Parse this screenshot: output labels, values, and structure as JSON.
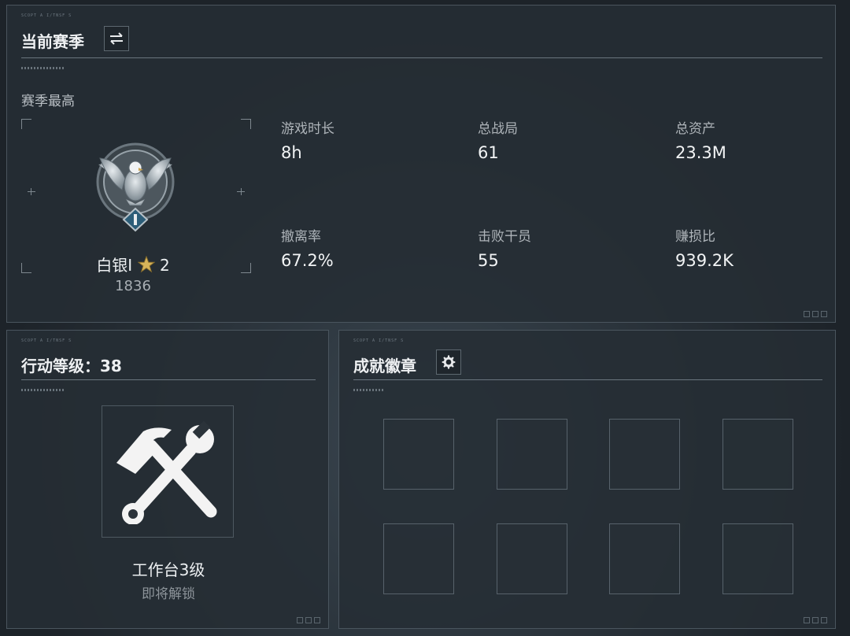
{
  "season": {
    "title": "当前赛季",
    "tiny_code": "SCOPT A I/TNSF S",
    "switch_icon": "swap-arrows-icon",
    "section_label": "赛季最高",
    "rank": {
      "name": "白银I",
      "star_icon": "gold-star-icon",
      "stars": "2",
      "score": "1836",
      "emblem_icon": "silver-eagle-emblem-icon"
    },
    "stats": [
      {
        "label": "游戏时长",
        "value": "8h"
      },
      {
        "label": "总战局",
        "value": "61"
      },
      {
        "label": "总资产",
        "value": "23.3M"
      },
      {
        "label": "撤离率",
        "value": "67.2%"
      },
      {
        "label": "击败干员",
        "value": "55"
      },
      {
        "label": "赚损比",
        "value": "939.2K"
      }
    ]
  },
  "level": {
    "title": "行动等级：38",
    "tiny_code": "SCOPT A I/TNSF S",
    "unlock_icon": "hammer-wrench-icon",
    "unlock_name": "工作台3级",
    "unlock_status": "即将解锁"
  },
  "badges": {
    "title": "成就徽章",
    "tiny_code": "SCOPT A I/TNSF S",
    "settings_icon": "gear-icon",
    "slots": 8
  },
  "colors": {
    "panel_border": "#4a555e",
    "text_primary": "#f2f4f5",
    "text_secondary": "#aeb4b9",
    "star_gold": "#d6b35a"
  }
}
